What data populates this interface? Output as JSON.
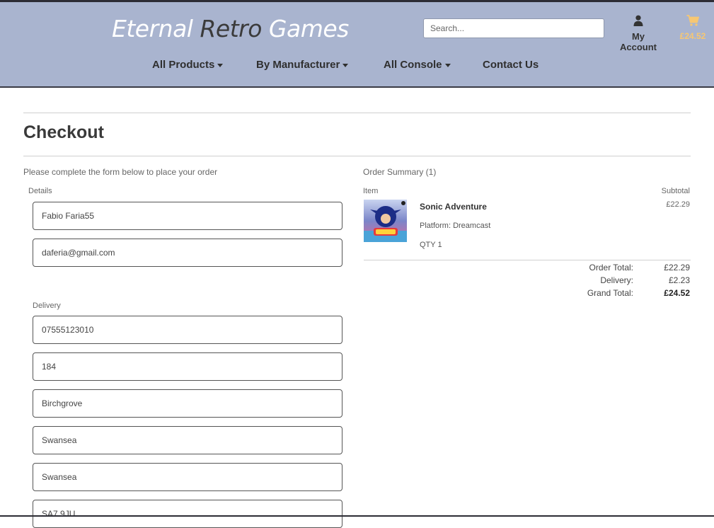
{
  "header": {
    "logo": {
      "word1": "Eternal",
      "word2": "Retro",
      "word3": "Games"
    },
    "search_placeholder": "Search...",
    "account_label": "My Account",
    "account_icon": "user-icon",
    "cart_total": "£24.52",
    "cart_icon": "shopping-cart-icon",
    "colors": {
      "header_bg": "#a9b4cf",
      "cart_accent": "#f7c772"
    }
  },
  "nav": {
    "items": [
      {
        "label": "All Products",
        "has_dropdown": true
      },
      {
        "label": "By Manufacturer",
        "has_dropdown": true
      },
      {
        "label": "All Console",
        "has_dropdown": true
      },
      {
        "label": "Contact Us",
        "has_dropdown": false
      }
    ]
  },
  "page": {
    "title": "Checkout",
    "instructions": "Please complete the form below to place your order"
  },
  "form": {
    "details_label": "Details",
    "details_fields": [
      {
        "value": "Fabio Faria55"
      },
      {
        "value": "daferia@gmail.com"
      }
    ],
    "delivery_label": "Delivery",
    "delivery_fields": [
      {
        "value": "07555123010"
      },
      {
        "value": "184"
      },
      {
        "value": "Birchgrove"
      },
      {
        "value": "Swansea"
      },
      {
        "value": "Swansea"
      },
      {
        "value": "SA7 9JU"
      }
    ]
  },
  "summary": {
    "title": "Order Summary (1)",
    "col_item": "Item",
    "col_subtotal": "Subtotal",
    "product": {
      "name": "Sonic Adventure",
      "platform": "Platform: Dreamcast",
      "qty": "QTY 1",
      "subtotal": "£22.29"
    },
    "totals": {
      "order_total_label": "Order Total:",
      "order_total": "£22.29",
      "delivery_label": "Delivery:",
      "delivery": "£2.23",
      "grand_total_label": "Grand Total:",
      "grand_total": "£24.52"
    }
  }
}
